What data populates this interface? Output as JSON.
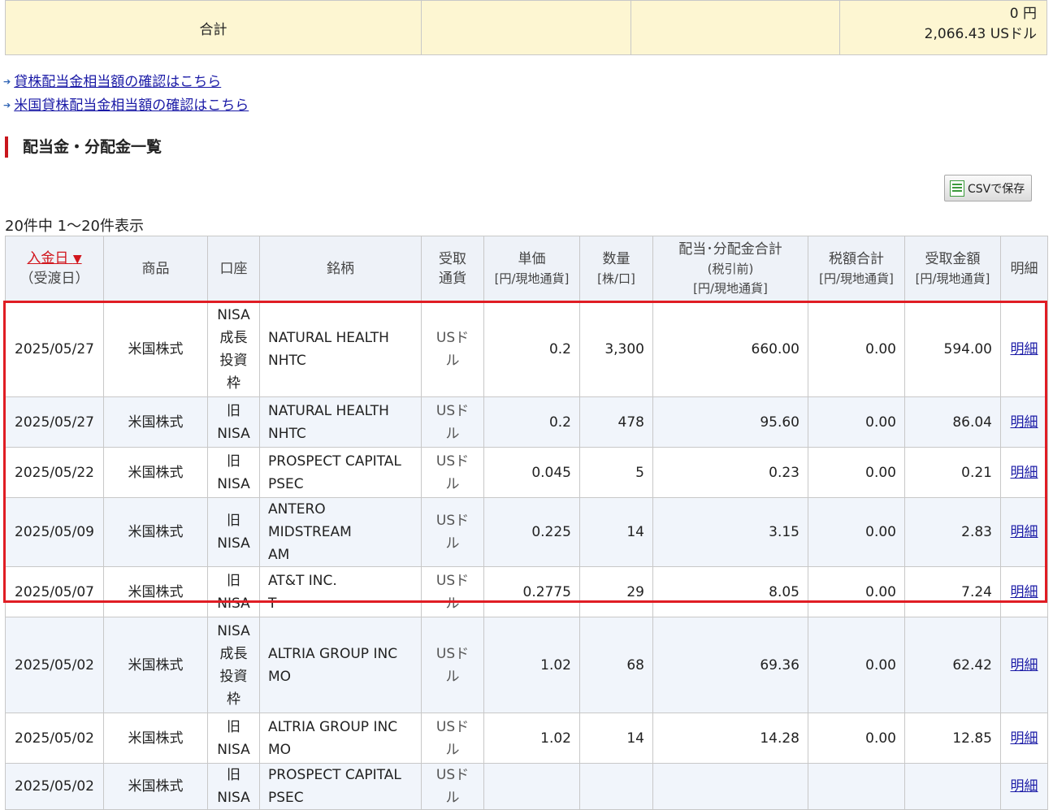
{
  "summary": {
    "label": "合計",
    "yen": "0 円",
    "usd": "2,066.43 USドル"
  },
  "links": [
    {
      "text": "貸株配当金相当額の確認はこちら"
    },
    {
      "text": "米国貸株配当金相当額の確認はこちら"
    }
  ],
  "section_title": "配当金・分配金一覧",
  "csv_button": "CSVで保存",
  "count_text": "20件中 1～20件表示",
  "headers": {
    "date": "入金日",
    "date_sort": "▼",
    "date_sub": "（受渡日）",
    "product": "商品",
    "account": "口座",
    "issue": "銘柄",
    "currency_1": "受取",
    "currency_2": "通貨",
    "price": "単価",
    "price_sub": "[円/現地通貨]",
    "qty": "数量",
    "qty_sub": "[株/口]",
    "gross_1": "配当･分配金合計",
    "gross_2": "(税引前)",
    "gross_sub": "[円/現地通貨]",
    "tax": "税額合計",
    "tax_sub": "[円/現地通貨]",
    "net": "受取金額",
    "net_sub": "[円/現地通貨]",
    "detail": "明細"
  },
  "rows": [
    {
      "date": "2025/05/27",
      "product": "米国株式",
      "account": [
        "NISA",
        "成長",
        "投資",
        "枠"
      ],
      "name": "NATURAL HEALTH",
      "ticker": "NHTC",
      "currency": "USドル",
      "price": "0.2",
      "qty": "3,300",
      "gross": "660.00",
      "tax": "0.00",
      "net": "594.00",
      "detail": "明細"
    },
    {
      "date": "2025/05/27",
      "product": "米国株式",
      "account": [
        "旧",
        "NISA"
      ],
      "name": "NATURAL HEALTH",
      "ticker": "NHTC",
      "currency": "USドル",
      "price": "0.2",
      "qty": "478",
      "gross": "95.60",
      "tax": "0.00",
      "net": "86.04",
      "detail": "明細"
    },
    {
      "date": "2025/05/22",
      "product": "米国株式",
      "account": [
        "旧",
        "NISA"
      ],
      "name": "PROSPECT CAPITAL",
      "ticker": "PSEC",
      "currency": "USドル",
      "price": "0.045",
      "qty": "5",
      "gross": "0.23",
      "tax": "0.00",
      "net": "0.21",
      "detail": "明細"
    },
    {
      "date": "2025/05/09",
      "product": "米国株式",
      "account": [
        "旧",
        "NISA"
      ],
      "name": "ANTERO MIDSTREAM",
      "ticker": "AM",
      "currency": "USドル",
      "price": "0.225",
      "qty": "14",
      "gross": "3.15",
      "tax": "0.00",
      "net": "2.83",
      "detail": "明細"
    },
    {
      "date": "2025/05/07",
      "product": "米国株式",
      "account": [
        "旧",
        "NISA"
      ],
      "name": "AT&T INC.",
      "ticker": "T",
      "currency": "USドル",
      "price": "0.2775",
      "qty": "29",
      "gross": "8.05",
      "tax": "0.00",
      "net": "7.24",
      "detail": "明細"
    },
    {
      "date": "2025/05/02",
      "product": "米国株式",
      "account": [
        "NISA",
        "成長",
        "投資",
        "枠"
      ],
      "name": "ALTRIA GROUP INC",
      "ticker": "MO",
      "currency": "USドル",
      "price": "1.02",
      "qty": "68",
      "gross": "69.36",
      "tax": "0.00",
      "net": "62.42",
      "detail": "明細"
    },
    {
      "date": "2025/05/02",
      "product": "米国株式",
      "account": [
        "旧",
        "NISA"
      ],
      "name": "ALTRIA GROUP INC",
      "ticker": "MO",
      "currency": "USドル",
      "price": "1.02",
      "qty": "14",
      "gross": "14.28",
      "tax": "0.00",
      "net": "12.85",
      "detail": "明細"
    },
    {
      "date": "2025/05/02",
      "product": "米国株式",
      "account": [
        "旧",
        "NISA"
      ],
      "name": "PROSPECT CAPITAL",
      "ticker": "PSEC",
      "currency": "USドル",
      "price": "",
      "qty": "",
      "gross": "",
      "tax": "",
      "net": "",
      "detail": "明細"
    }
  ],
  "colors": {
    "highlight": "#e01d24",
    "header_bg": "#eef2f8",
    "summary_bg": "#fdf6d2",
    "link": "#1a1aa6"
  }
}
